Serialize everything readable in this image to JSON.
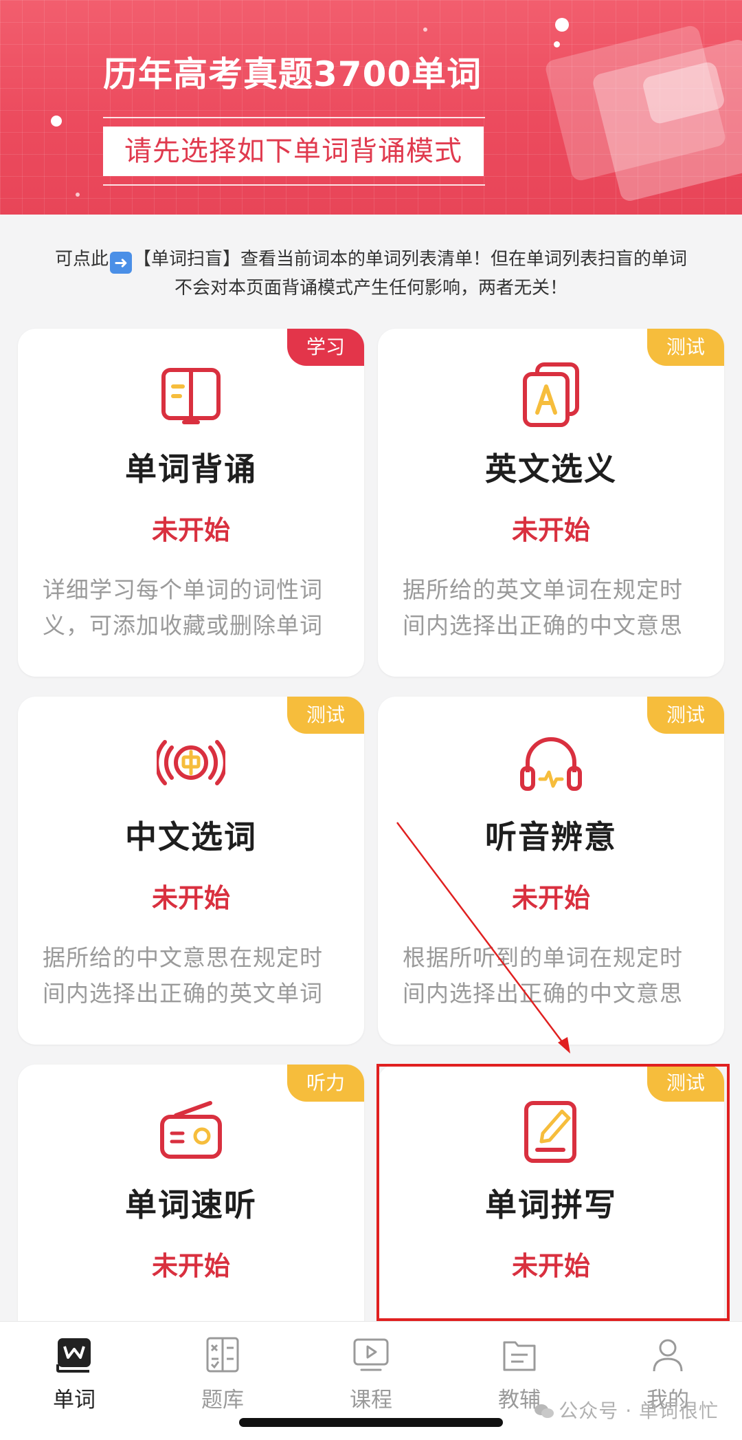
{
  "banner": {
    "title": "历年高考真题3700单词",
    "subtitle": "请先选择如下单词背诵模式"
  },
  "notice": {
    "line1_prefix": "可点此",
    "line1_suffix": "【单词扫盲】查看当前词本的单词列表清单！但在单词列表扫盲的单词",
    "line2": "不会对本页面背诵模式产生任何影响，两者无关！"
  },
  "cards": [
    {
      "tag": "学习",
      "tag_color": "#e3354a",
      "icon": "open-book-icon",
      "name": "单词背诵",
      "status": "未开始",
      "desc": "详细学习每个单词的词性词义，可添加收藏或删除单词"
    },
    {
      "tag": "测试",
      "tag_color": "#f6bd3c",
      "icon": "letter-a-cards-icon",
      "name": "英文选义",
      "status": "未开始",
      "desc": "据所给的英文单词在规定时间内选择出正确的中文意思"
    },
    {
      "tag": "测试",
      "tag_color": "#f6bd3c",
      "icon": "chinese-broadcast-icon",
      "name": "中文选词",
      "status": "未开始",
      "desc": "据所给的中文意思在规定时间内选择出正确的英文单词"
    },
    {
      "tag": "测试",
      "tag_color": "#f6bd3c",
      "icon": "headphones-icon",
      "name": "听音辨意",
      "status": "未开始",
      "desc": "根据所听到的单词在规定时间内选择出正确的中文意思"
    },
    {
      "tag": "听力",
      "tag_color": "#f6bd3c",
      "icon": "radio-icon",
      "name": "单词速听",
      "status": "未开始",
      "desc": ""
    },
    {
      "tag": "测试",
      "tag_color": "#f6bd3c",
      "icon": "edit-pencil-icon",
      "name": "单词拼写",
      "status": "未开始",
      "desc": ""
    }
  ],
  "tabbar": {
    "active": 0,
    "items": [
      {
        "label": "单词",
        "icon": "word-book-icon"
      },
      {
        "label": "题库",
        "icon": "question-bank-icon"
      },
      {
        "label": "课程",
        "icon": "video-play-icon"
      },
      {
        "label": "教辅",
        "icon": "folder-doc-icon"
      },
      {
        "label": "我的",
        "icon": "user-icon"
      }
    ]
  },
  "watermark": "公众号 · 单词很忙",
  "colors": {
    "accent_red": "#d9303f",
    "tag_yellow": "#f6bd3c",
    "tag_red": "#e3354a",
    "banner": "#ec4b5e"
  }
}
